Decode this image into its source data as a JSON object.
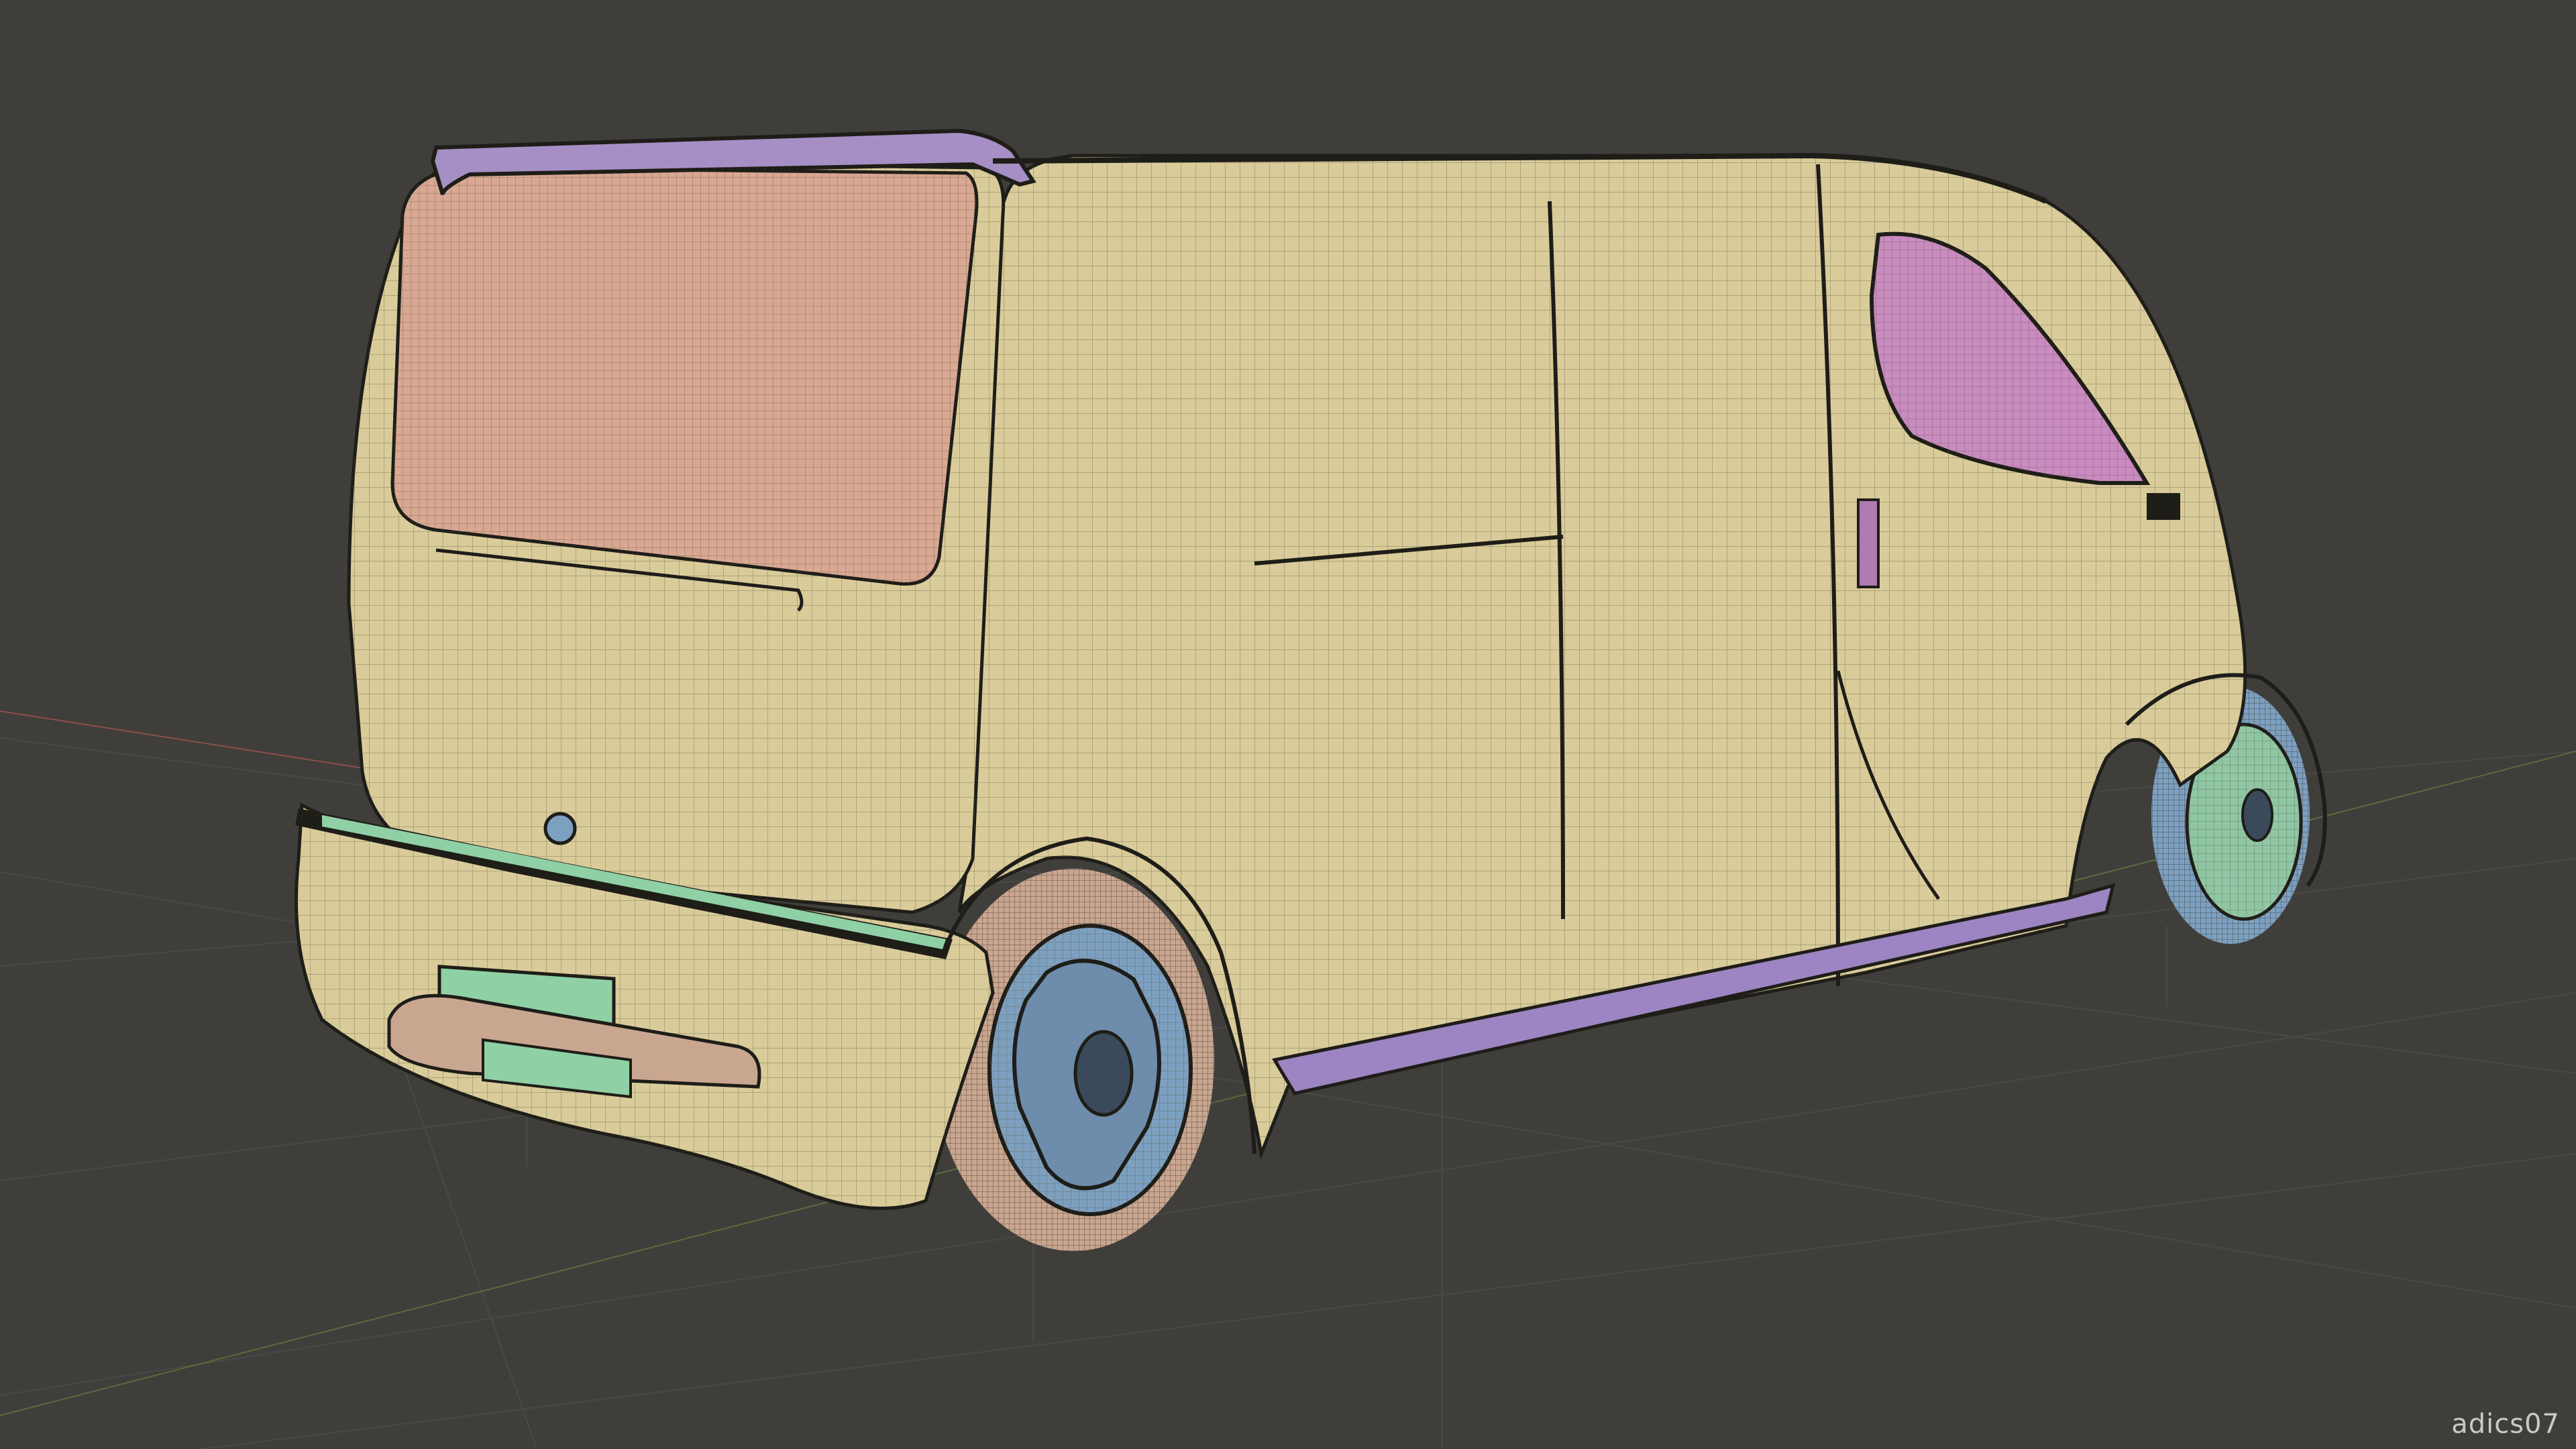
{
  "viewport": {
    "background": "#3f3e3b",
    "grid_color": "#4a4946",
    "axis_x_color": "#8a5048",
    "axis_y_color": "#6b8a3e",
    "display_mode": "wireframe-on-shaded"
  },
  "model": {
    "object": "van",
    "colors": {
      "body": "#d9cc9a",
      "rear_window": "#d9a893",
      "side_window": "#c98bc0",
      "spoiler": "#a68fc4",
      "trim": "#9c85c2",
      "bumper_parts": "#8fd0a5",
      "wheel_hub": "#7da0c0",
      "tire": "#c9a690",
      "wire": "#5a5540",
      "dark": "#1e1d18"
    }
  },
  "watermark": {
    "text": "adics07"
  }
}
